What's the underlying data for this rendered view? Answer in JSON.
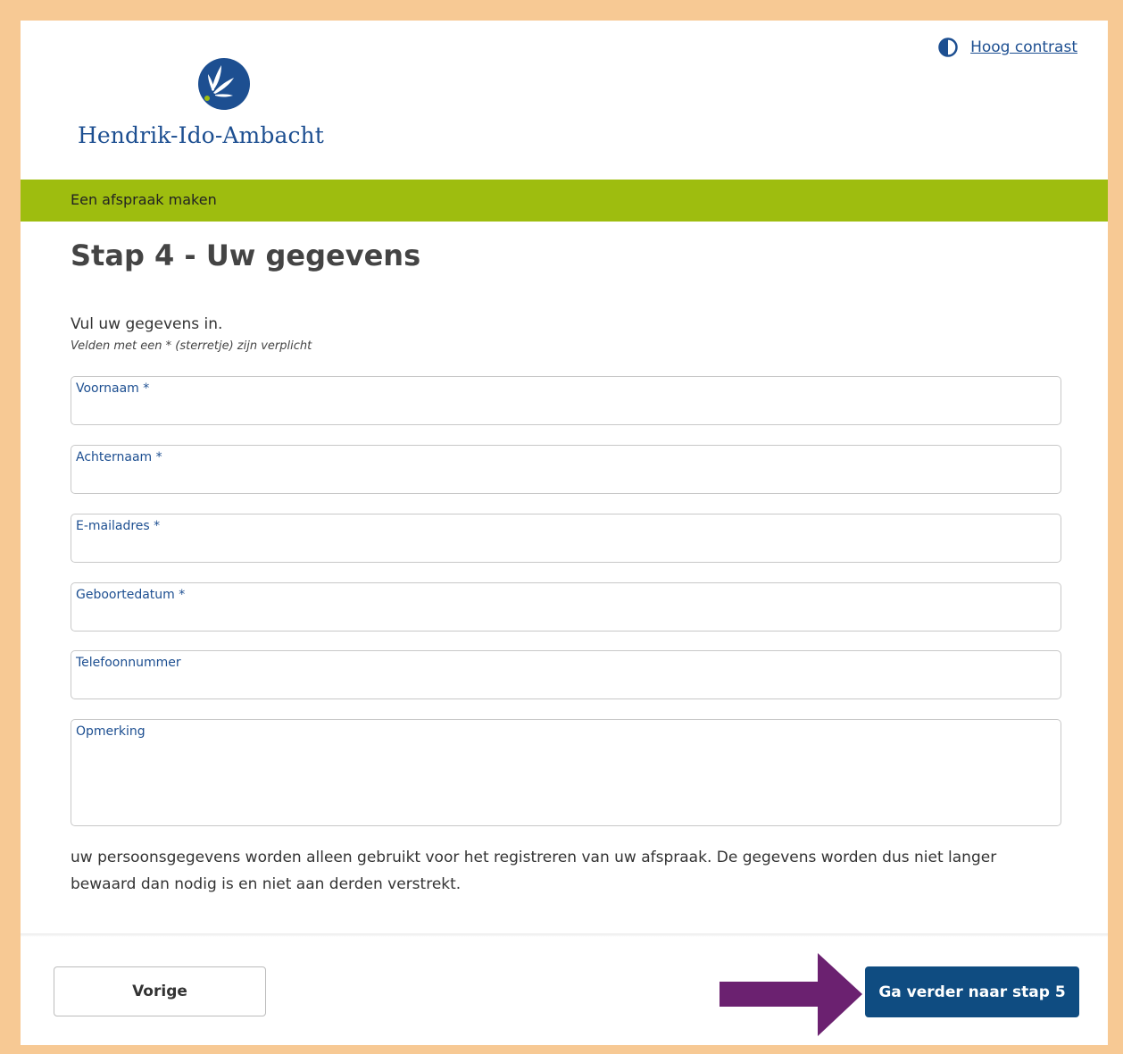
{
  "header": {
    "contrast_label": "Hoog contrast",
    "logo_text": "Hendrik-Ido-Ambacht"
  },
  "banner": {
    "title": "Een afspraak maken"
  },
  "main": {
    "page_title": "Stap 4 - Uw gegevens",
    "intro": "Vul uw gegevens in.",
    "required_note": "Velden met een * (sterretje) zijn verplicht",
    "fields": [
      {
        "label": "Voornaam *",
        "value": ""
      },
      {
        "label": "Achternaam *",
        "value": ""
      },
      {
        "label": "E-mailadres *",
        "value": ""
      },
      {
        "label": "Geboortedatum *",
        "value": ""
      },
      {
        "label": "Telefoonnummer",
        "value": ""
      },
      {
        "label": "Opmerking",
        "value": ""
      }
    ],
    "privacy_text": "uw persoonsgegevens worden alleen gebruikt voor het registreren van uw afspraak. De gegevens worden dus niet langer bewaard dan nodig is en niet aan derden verstrekt."
  },
  "footer": {
    "prev_label": "Vorige",
    "next_label": "Ga verder naar stap 5"
  },
  "colors": {
    "border_accent": "#f7c994",
    "banner_green": "#9ebd0f",
    "brand_blue": "#1d4f91",
    "button_blue": "#0f4c81",
    "arrow_purple": "#6b2170"
  },
  "icons": {
    "contrast": "half-circle-contrast-icon",
    "logo": "flower-logo-icon",
    "annotation": "arrow-right-icon"
  }
}
